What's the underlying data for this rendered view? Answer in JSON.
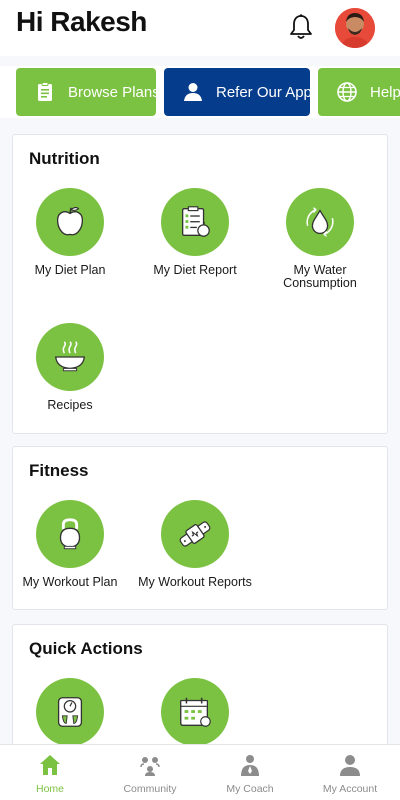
{
  "header": {
    "greeting": "Hi Rakesh"
  },
  "chips": [
    {
      "label": "Browse Plans",
      "icon": "clipboard-icon"
    },
    {
      "label": "Refer Our App",
      "icon": "person-icon"
    },
    {
      "label": "Help",
      "icon": "globe-icon"
    }
  ],
  "nutrition": {
    "title": "Nutrition",
    "items": [
      {
        "label": "My Diet Plan",
        "icon": "apple-icon"
      },
      {
        "label": "My Diet Report",
        "icon": "report-icon"
      },
      {
        "label": "My Water Consumption",
        "icon": "water-drop-icon"
      },
      {
        "label": "Recipes",
        "icon": "bowl-icon"
      }
    ]
  },
  "fitness": {
    "title": "Fitness",
    "items": [
      {
        "label": "My Workout Plan",
        "icon": "kettlebell-icon"
      },
      {
        "label": "My Workout Reports",
        "icon": "fitness-band-icon"
      }
    ]
  },
  "quick_actions": {
    "title": "Quick Actions",
    "items": [
      {
        "icon": "weighing-scale-icon"
      },
      {
        "icon": "calendar-icon"
      }
    ]
  },
  "bottom_nav": [
    {
      "label": "Home",
      "icon": "home-icon",
      "active": true
    },
    {
      "label": "Community",
      "icon": "community-icon"
    },
    {
      "label": "My Coach",
      "icon": "coach-icon"
    },
    {
      "label": "My Account",
      "icon": "account-icon"
    }
  ],
  "colors": {
    "green": "#7cc242",
    "blue": "#053c8c",
    "nav_inactive": "#8c8c8c"
  }
}
